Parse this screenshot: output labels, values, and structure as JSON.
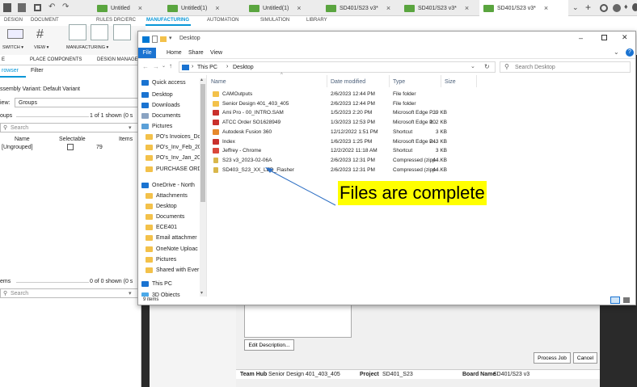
{
  "tabs": [
    {
      "label": "Untitled",
      "active": false
    },
    {
      "label": "Untitled(1)",
      "active": false
    },
    {
      "label": "Untitled(1)",
      "active": false
    },
    {
      "label": "SD401/S23 v3*",
      "active": false
    },
    {
      "label": "SD401/S23 v3*",
      "active": false
    },
    {
      "label": "SD401/S23 v3*",
      "active": true
    }
  ],
  "menus": [
    "DESIGN",
    "DOCUMENT",
    "RULES DRC/ERC",
    "MANUFACTURING",
    "AUTOMATION",
    "SIMULATION",
    "LIBRARY"
  ],
  "ribbon": {
    "switch": "SWITCH ▾",
    "view": "VIEW ▾",
    "manufacturing": "MANUFACTURING ▾"
  },
  "left": {
    "tabs": [
      "PLACE COMPONENTS",
      "DESIGN MANAGER"
    ],
    "subtabs": [
      "rowser",
      "Filter"
    ],
    "assembly": "ssembly Variant:  Default Variant",
    "view_label": "iew:",
    "view_value": "Groups",
    "groups_label": "oups",
    "groups_count": "1 of 1 shown (0 s",
    "search_placeholder": "Search",
    "cols": [
      "Name",
      "Selectable",
      "Items"
    ],
    "row_name": "[Ungrouped]",
    "row_items": "79",
    "items_label": "ems",
    "items_count": "0 of 0 shown (0 s",
    "search2_placeholder": "Search"
  },
  "explorer": {
    "title": "Desktop",
    "ribbon_tabs": [
      "File",
      "Home",
      "Share",
      "View"
    ],
    "path": [
      "This PC",
      "Desktop"
    ],
    "search_placeholder": "Search Desktop",
    "columns": [
      "Name",
      "Date modified",
      "Type",
      "Size"
    ],
    "nav": [
      {
        "label": "Quick access",
        "kind": "star"
      },
      {
        "label": "Desktop",
        "kind": "blue"
      },
      {
        "label": "Downloads",
        "kind": "down"
      },
      {
        "label": "Documents",
        "kind": "doc"
      },
      {
        "label": "Pictures",
        "kind": "pic"
      },
      {
        "label": "PO's Invoices_Dc",
        "kind": "folder"
      },
      {
        "label": "PO's_Inv_Feb_20",
        "kind": "folder"
      },
      {
        "label": "PO's_Inv_Jan_20.",
        "kind": "folder"
      },
      {
        "label": "PURCHASE ORD",
        "kind": "folder"
      },
      {
        "label": "OneDrive - North",
        "kind": "cloud"
      },
      {
        "label": "Attachments",
        "kind": "folder"
      },
      {
        "label": "Desktop",
        "kind": "folder"
      },
      {
        "label": "Documents",
        "kind": "folder"
      },
      {
        "label": "ECE401",
        "kind": "folder"
      },
      {
        "label": "Email attachmer",
        "kind": "folder"
      },
      {
        "label": "OneNote Uploac",
        "kind": "folder"
      },
      {
        "label": "Pictures",
        "kind": "folder"
      },
      {
        "label": "Shared with Ever",
        "kind": "folder"
      },
      {
        "label": "This PC",
        "kind": "pc"
      },
      {
        "label": "3D Objects",
        "kind": "obj"
      }
    ],
    "files": [
      {
        "name": "CAMOutputs",
        "date": "2/6/2023 12:44 PM",
        "type": "File folder",
        "size": "",
        "icon": "folder"
      },
      {
        "name": "Senior Design 401_403_405",
        "date": "2/6/2023 12:44 PM",
        "type": "File folder",
        "size": "",
        "icon": "folder"
      },
      {
        "name": "Ami Pro - 00_INTRO.SAM",
        "date": "1/5/2023 2:20 PM",
        "type": "Microsoft Edge P...",
        "size": "39 KB",
        "icon": "pdf"
      },
      {
        "name": "ATCC Order SO1628949",
        "date": "1/3/2023 12:53 PM",
        "type": "Microsoft Edge P...",
        "size": "102 KB",
        "icon": "pdf"
      },
      {
        "name": "Autodesk Fusion 360",
        "date": "12/12/2022 1:51 PM",
        "type": "Shortcut",
        "size": "3 KB",
        "icon": "fusion"
      },
      {
        "name": "Index",
        "date": "1/6/2023 1:25 PM",
        "type": "Microsoft Edge P...",
        "size": "243 KB",
        "icon": "pdf"
      },
      {
        "name": "Jeffrey - Chrome",
        "date": "12/2/2022 11:18 AM",
        "type": "Shortcut",
        "size": "3 KB",
        "icon": "chrome"
      },
      {
        "name": "S23 v3_2023-02-06A",
        "date": "2/6/2023 12:31 PM",
        "type": "Compressed (zipp...",
        "size": "44 KB",
        "icon": "zip"
      },
      {
        "name": "SD403_S23_XX_LED_Flasher",
        "date": "2/6/2023 12:31 PM",
        "type": "Compressed (zipp...",
        "size": "44 KB",
        "icon": "zip"
      }
    ],
    "status": "9 items"
  },
  "annotation": "Files are complete",
  "dialog": {
    "edit_description": "Edit Description...",
    "process_job": "Process Job",
    "cancel": "Cancel",
    "team_hub_label": "Team Hub",
    "team_hub_value": "Senior Design 401_403_405",
    "project_label": "Project",
    "project_value": "SD401_S23",
    "board_label": "Board Name",
    "board_value": "SD401/S23 v3"
  },
  "colors": {
    "accent": "#0078d4",
    "highlight": "#ffff00",
    "annotation_line": "#2d6fc4"
  }
}
